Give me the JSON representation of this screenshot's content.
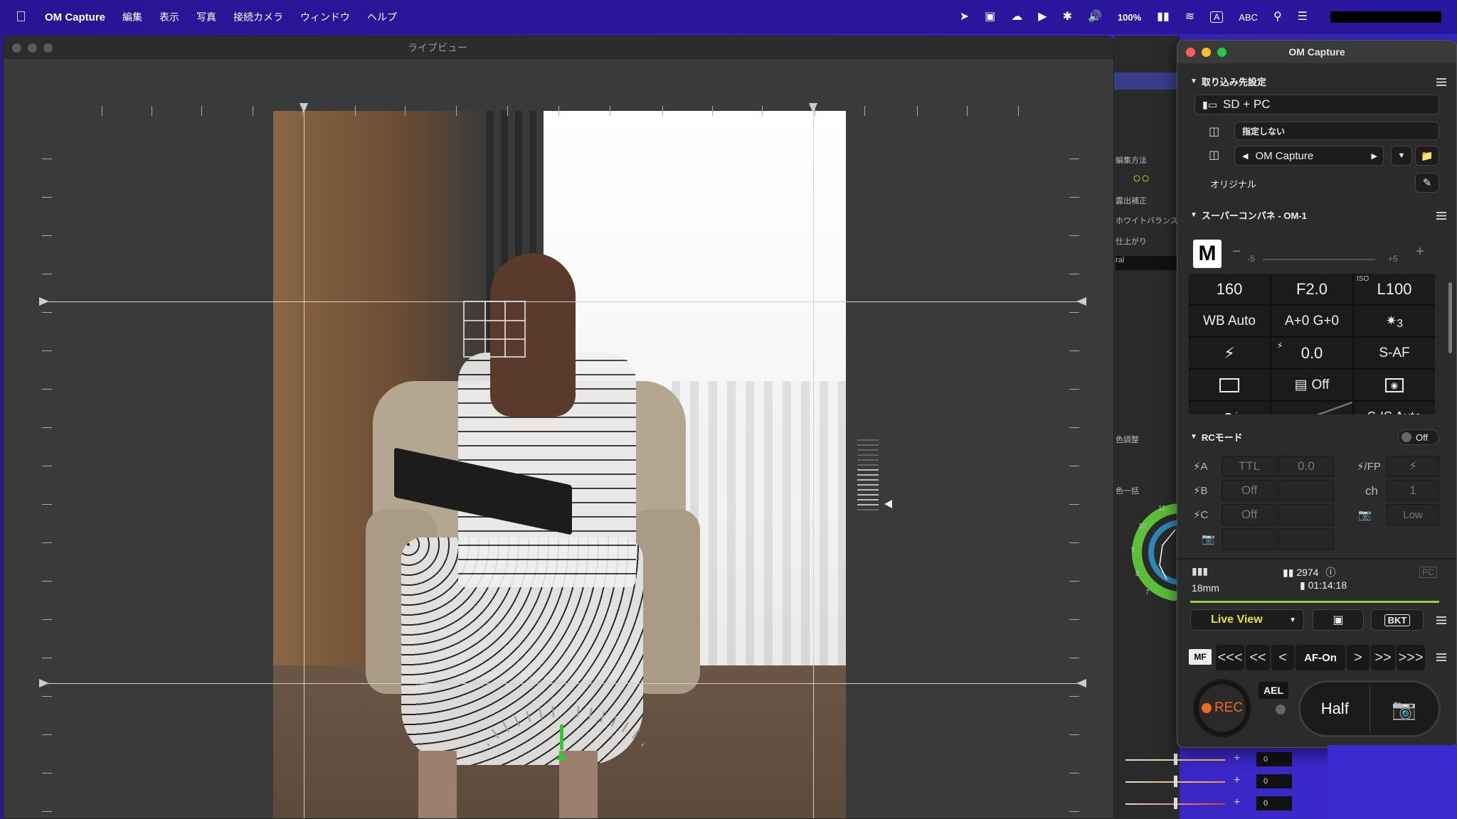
{
  "menubar": {
    "app_name": "OM Capture",
    "menus": [
      "編集",
      "表示",
      "写真",
      "接続カメラ",
      "ウィンドウ",
      "ヘルプ"
    ],
    "battery": "100%",
    "input_mode": "ABC",
    "input_icon": "A"
  },
  "liveview": {
    "title": "ライブビュー"
  },
  "bg_side": {
    "labels": [
      "編集方法",
      "露出補正",
      "ホワイトバランス",
      "仕上がり",
      "ral",
      "色調整",
      "色一括"
    ],
    "wheel_nums": [
      "11",
      "10",
      "9",
      "8",
      "7"
    ],
    "slider_values": [
      "0",
      "0",
      "0"
    ]
  },
  "om_panel": {
    "title": "OM Capture",
    "import": {
      "header": "取り込み先設定",
      "destination": "SD + PC",
      "folder_option": "指定しない",
      "folder_name": "OM Capture",
      "original_label": "オリジナル"
    },
    "scp": {
      "header": "スーパーコンパネ - OM-1",
      "mode": "M",
      "scale_min": "-5",
      "scale_max": "+5",
      "rows": [
        [
          "160",
          "F2.0",
          "L100"
        ],
        [
          "WB Auto",
          "A+0 G+0",
          "3"
        ],
        [
          "",
          "0.0",
          "S-AF"
        ],
        [
          "",
          "Off",
          ""
        ],
        [
          "i",
          "",
          "S-IS Auto"
        ]
      ],
      "iso_label": "ISO"
    },
    "rc": {
      "header": "RCモード",
      "toggle": "Off",
      "rows": [
        {
          "label": "A",
          "v1": "TTL",
          "v2": "0.0"
        },
        {
          "label": "B",
          "v1": "Off",
          "v2": ""
        },
        {
          "label": "C",
          "v1": "Off",
          "v2": ""
        }
      ],
      "right_rows": [
        {
          "label": "/FP",
          "value": ""
        },
        {
          "label": "ch",
          "value": "1"
        },
        {
          "label": "",
          "value": "Low"
        }
      ]
    },
    "status": {
      "focal": "18mm",
      "shots": "2974",
      "time": "01:14:18",
      "pc_badge": "PC"
    },
    "controls": {
      "live_view": "Live View",
      "bkt": "BKT",
      "mf": "MF",
      "af_on": "AF-On",
      "arrows_left": [
        "<<<",
        "<<",
        "<"
      ],
      "arrows_right": [
        ">",
        ">>",
        ">>>"
      ],
      "rec": "REC",
      "ael": "AEL",
      "half": "Half"
    }
  }
}
